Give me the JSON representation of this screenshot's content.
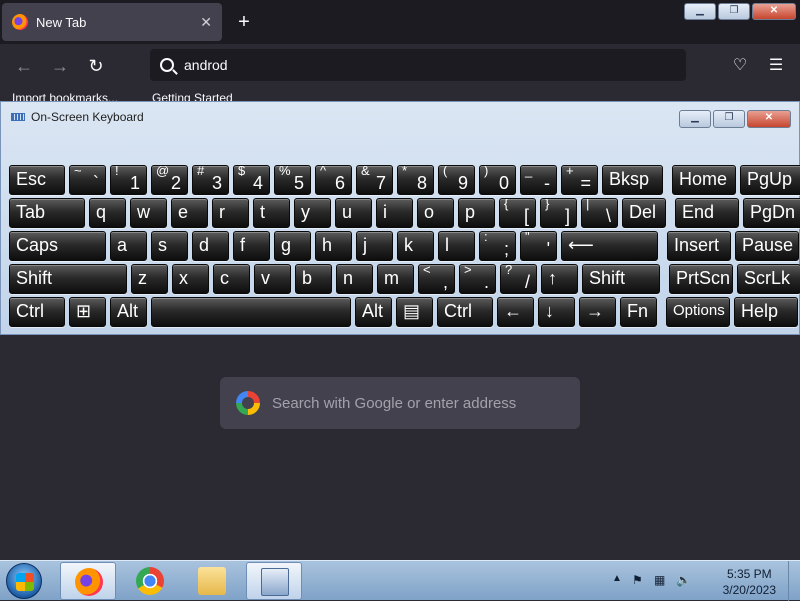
{
  "browser": {
    "tab_title": "New Tab",
    "tab_close": "✕",
    "new_tab": "+",
    "url_text": "androd",
    "bookmarks": [
      "Import bookmarks...",
      "Getting Started"
    ]
  },
  "window_controls": {
    "minimize": "▁",
    "maximize": "❐",
    "close": "✕"
  },
  "search_box": {
    "placeholder": "Search with Google or enter address"
  },
  "osk": {
    "title": "On-Screen Keyboard",
    "rows": [
      [
        {
          "label": "Esc"
        },
        {
          "top": "~",
          "main": "`"
        },
        {
          "top": "!",
          "main": "1"
        },
        {
          "top": "@",
          "main": "2"
        },
        {
          "top": "#",
          "main": "3"
        },
        {
          "top": "$",
          "main": "4"
        },
        {
          "top": "%",
          "main": "5"
        },
        {
          "top": "^",
          "main": "6"
        },
        {
          "top": "&",
          "main": "7"
        },
        {
          "top": "*",
          "main": "8"
        },
        {
          "top": "(",
          "main": "9"
        },
        {
          "top": ")",
          "main": "0"
        },
        {
          "top": "_",
          "main": "-"
        },
        {
          "top": "+",
          "main": "="
        },
        {
          "label": "Bksp"
        },
        {
          "label": "Home"
        },
        {
          "label": "PgUp"
        }
      ],
      [
        {
          "label": "Tab"
        },
        {
          "label": "q"
        },
        {
          "label": "w"
        },
        {
          "label": "e"
        },
        {
          "label": "r"
        },
        {
          "label": "t"
        },
        {
          "label": "y"
        },
        {
          "label": "u"
        },
        {
          "label": "i"
        },
        {
          "label": "o"
        },
        {
          "label": "p"
        },
        {
          "top": "{",
          "main": "["
        },
        {
          "top": "}",
          "main": "]"
        },
        {
          "top": "|",
          "main": "\\"
        },
        {
          "label": "Del"
        },
        {
          "label": "End"
        },
        {
          "label": "PgDn"
        }
      ],
      [
        {
          "label": "Caps"
        },
        {
          "label": "a"
        },
        {
          "label": "s"
        },
        {
          "label": "d"
        },
        {
          "label": "f"
        },
        {
          "label": "g"
        },
        {
          "label": "h"
        },
        {
          "label": "j"
        },
        {
          "label": "k"
        },
        {
          "label": "l"
        },
        {
          "top": ":",
          "main": ";"
        },
        {
          "top": "\"",
          "main": "'"
        },
        {
          "label": "⟵"
        },
        {
          "label": "Insert"
        },
        {
          "label": "Pause"
        }
      ],
      [
        {
          "label": "Shift"
        },
        {
          "label": "z"
        },
        {
          "label": "x"
        },
        {
          "label": "c"
        },
        {
          "label": "v"
        },
        {
          "label": "b"
        },
        {
          "label": "n"
        },
        {
          "label": "m"
        },
        {
          "top": "<",
          "main": ","
        },
        {
          "top": ">",
          "main": "."
        },
        {
          "top": "?",
          "main": "/"
        },
        {
          "label": "↑"
        },
        {
          "label": "Shift"
        },
        {
          "label": "PrtScn"
        },
        {
          "label": "ScrLk"
        }
      ],
      [
        {
          "label": "Ctrl"
        },
        {
          "label": "⊞"
        },
        {
          "label": "Alt"
        },
        {
          "label": ""
        },
        {
          "label": "Alt"
        },
        {
          "label": "▤"
        },
        {
          "label": "Ctrl"
        },
        {
          "label": "←"
        },
        {
          "label": "↓"
        },
        {
          "label": "→"
        },
        {
          "label": "Fn"
        },
        {
          "label": "Options"
        },
        {
          "label": "Help"
        }
      ]
    ]
  },
  "taskbar": {
    "apps": [
      "Firefox",
      "Google Chrome",
      "File Explorer",
      "On-Screen Keyboard"
    ],
    "clock_time": "5:35 PM",
    "clock_date": "3/20/2023"
  }
}
